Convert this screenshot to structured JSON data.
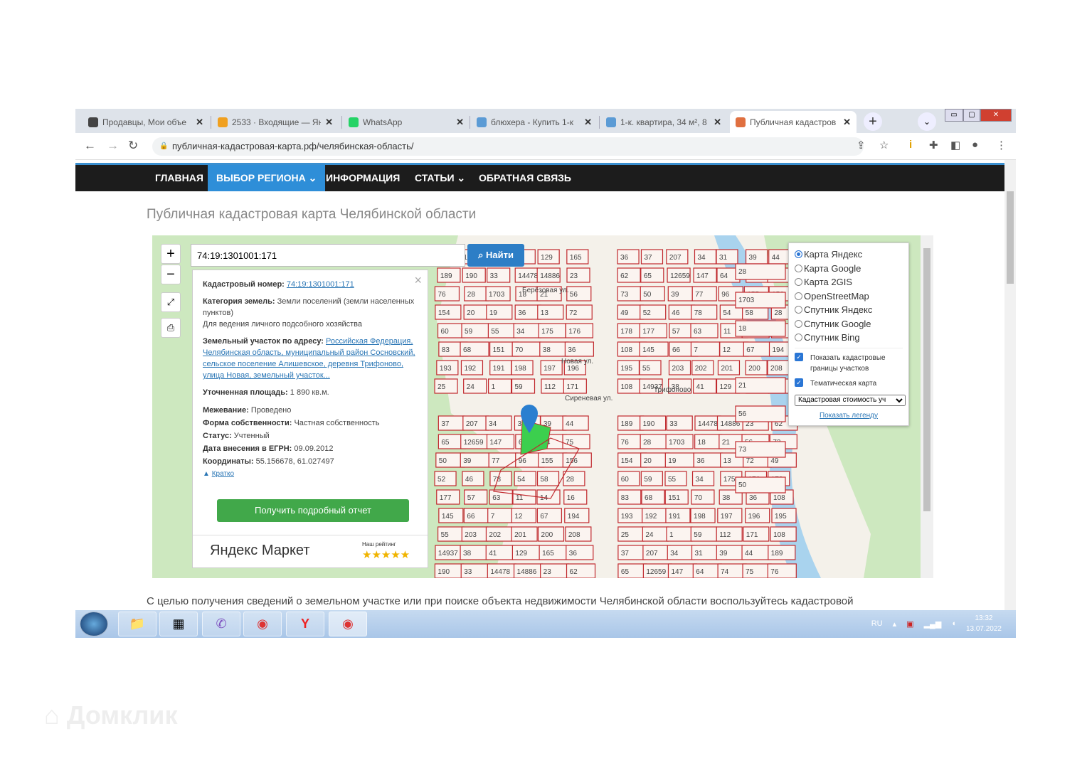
{
  "browser": {
    "tabs": [
      {
        "title": "Продавцы, Мои объе",
        "icon_color": "#444"
      },
      {
        "title": "2533 · Входящие — Ян",
        "icon_color": "#f0a020"
      },
      {
        "title": "WhatsApp",
        "icon_color": "#25d366"
      },
      {
        "title": "блюхера - Купить 1-к",
        "icon_color": "#5b9bd5"
      },
      {
        "title": "1-к. квартира, 34 м², 8",
        "icon_color": "#5b9bd5"
      },
      {
        "title": "Публичная кадастров",
        "icon_color": "#e07040",
        "active": true
      }
    ],
    "url": "публичная-кадастровая-карта.рф/челябинская-область/"
  },
  "site": {
    "menu": [
      "ГЛАВНАЯ",
      "ВЫБОР РЕГИОНА ⌄",
      "ИНФОРМАЦИЯ",
      "СТАТЬИ ⌄",
      "ОБРАТНАЯ СВЯЗЬ"
    ],
    "page_title": "Публичная кадастровая карта Челябинской области",
    "body_text": "С целью получения сведений о земельном участке или при поиске объекта недвижимости Челябинской области воспользуйтесь кадастровой"
  },
  "map": {
    "search_value": "74:19:1301001:171",
    "find_label": "Найти",
    "zoom_in": "+",
    "zoom_out": "−",
    "popup": {
      "cad_label": "Кадастровый номер:",
      "cad_value": "74:19:1301001:171",
      "cat_label": "Категория земель:",
      "cat_value": "Земли поселений (земли населенных пунктов)",
      "use_value": "Для ведения личного подсобного хозяйства",
      "addr_label": "Земельный участок по адресу:",
      "addr_value": "Российская Федерация, Челябинская область, муниципальный район Сосновский, сельское поселение Алишевское, деревня Трифоново, улица Новая, земельный участок...",
      "area_label": "Уточненная площадь:",
      "area_value": "1 890 кв.м.",
      "survey_label": "Межевание:",
      "survey_value": "Проведено",
      "own_label": "Форма собственности:",
      "own_value": "Частная собственность",
      "status_label": "Статус:",
      "status_value": "Учтенный",
      "date_label": "Дата внесения в ЕГРН:",
      "date_value": "09.09.2012",
      "coord_label": "Координаты:",
      "coord_value": "55.156678, 61.027497",
      "brief": "Кратко",
      "report_button": "Получить подробный отчет",
      "market_logo": "Яндекс Маркет",
      "rating_label": "Наш рейтинг",
      "stars": "★★★★★"
    },
    "layers": {
      "options": [
        "Карта Яндекс",
        "Карта Google",
        "Карта 2GIS",
        "OpenStreetMap",
        "Спутник Яндекс",
        "Спутник Google",
        "Спутник Bing"
      ],
      "selected": 0,
      "check_boundaries": "Показать кадастровые границы участков",
      "check_thematic": "Тематическая карта",
      "select_value": "Кадастровая стоимость уч",
      "legend_link": "Показать легенду"
    },
    "streets": [
      "Берёзовая ул.",
      "Новая ул.",
      "Сиреневая ул.",
      "Трифоново"
    ],
    "parcels": [
      "108",
      "14937",
      "38",
      "41",
      "129",
      "165",
      "36",
      "37",
      "207",
      "34",
      "31",
      "39",
      "44",
      "189",
      "190",
      "33",
      "14478",
      "14886",
      "23",
      "62",
      "65",
      "12659",
      "147",
      "64",
      "74",
      "75",
      "76",
      "28",
      "1703",
      "18",
      "21",
      "56",
      "73",
      "50",
      "39",
      "77",
      "96",
      "155",
      "156",
      "154",
      "20",
      "19",
      "36",
      "13",
      "72",
      "49",
      "52",
      "46",
      "78",
      "54",
      "58",
      "28",
      "60",
      "59",
      "55",
      "34",
      "175",
      "176",
      "178",
      "177",
      "57",
      "63",
      "11",
      "14",
      "16",
      "83",
      "68",
      "151",
      "70",
      "38",
      "36",
      "108",
      "145",
      "66",
      "7",
      "12",
      "67",
      "194",
      "193",
      "192",
      "191",
      "198",
      "197",
      "196",
      "195",
      "55",
      "203",
      "202",
      "201",
      "200",
      "208",
      "25",
      "24",
      "1",
      "59",
      "112",
      "171"
    ]
  },
  "taskbar": {
    "lang": "RU",
    "time": "13:32",
    "date": "13.07.2022"
  },
  "watermark": "Домклик",
  "colors": {
    "menu_active": "#2e8ed8",
    "find": "#2d7ec6",
    "report": "#41a84a",
    "parcel": "#c0282d",
    "selected_parcel": "#3ccf4e"
  }
}
